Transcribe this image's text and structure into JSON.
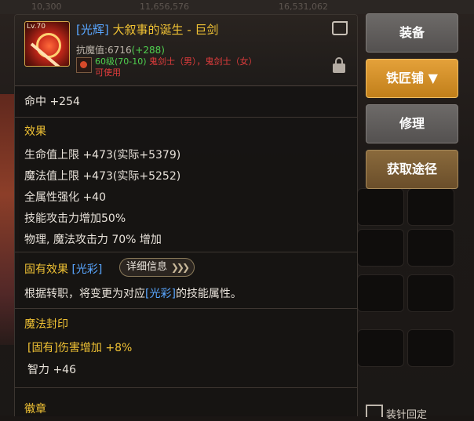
{
  "item": {
    "level": "Lv.70",
    "tag": "[光辉]",
    "name": " 大叙事的诞生 - 巨剑",
    "resist_label": "抗魔值:6716",
    "resist_bonus": "(+288)",
    "level_req": "60级(70-10)",
    "classes": " 鬼剑士（男），鬼剑士（女）",
    "usable": "可使用"
  },
  "stats": {
    "hit": "命中 +254",
    "effect_title": "效果",
    "lines": [
      "生命值上限 +473(实际+5379)",
      "魔法值上限 +473(实际+5252)",
      "全属性强化 +40",
      "技能攻击力增加50%",
      "物理, 魔法攻击力 70% 增加"
    ]
  },
  "inherent": {
    "label": "固有效果 ",
    "tag": "[光彩]",
    "detail_button": "详细信息",
    "desc_prefix": "根据转职，将变更为对应",
    "desc_tag": "[光彩]",
    "desc_suffix": "的技能属性。"
  },
  "seal": {
    "title": "魔法封印",
    "line1": "[固有]伤害增加 +8%",
    "line2": "智力 +46"
  },
  "emblem": {
    "title": "徽章"
  },
  "actions": {
    "equip": "装备",
    "smith": "铁匠铺 ▼",
    "repair": "修理",
    "source": "获取途径"
  },
  "bottom": {
    "label": "装针回定"
  },
  "topbar": {
    "v1": "10,300",
    "v2": "11,656,576",
    "v3": "16,531,062"
  },
  "colors": {
    "gold": "#f0c234",
    "blue_tag": "#59a6ff",
    "green": "#4fd04f",
    "red": "#e03c3c",
    "smith_orange": "#e4a13a"
  }
}
